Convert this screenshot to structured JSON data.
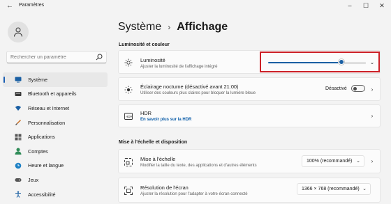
{
  "app": {
    "title": "Paramètres"
  },
  "search": {
    "placeholder": "Rechercher un paramètre"
  },
  "nav": {
    "items": [
      {
        "label": "Système",
        "icon": "monitor-icon",
        "active": true
      },
      {
        "label": "Bluetooth et appareils",
        "icon": "bluetooth-icon"
      },
      {
        "label": "Réseau et Internet",
        "icon": "wifi-icon"
      },
      {
        "label": "Personnalisation",
        "icon": "brush-icon"
      },
      {
        "label": "Applications",
        "icon": "apps-icon"
      },
      {
        "label": "Comptes",
        "icon": "person-icon"
      },
      {
        "label": "Heure et langue",
        "icon": "globe-clock-icon"
      },
      {
        "label": "Jeux",
        "icon": "gamepad-icon"
      },
      {
        "label": "Accessibilité",
        "icon": "accessibility-icon"
      }
    ]
  },
  "breadcrumb": {
    "parent": "Système",
    "separator": "›",
    "current": "Affichage"
  },
  "sections": {
    "brightness": "Luminosité et couleur",
    "scale": "Mise à l'échelle et disposition"
  },
  "cards": {
    "brightness": {
      "title": "Luminosité",
      "subtitle": "Ajuster la luminosité de l'affichage intégré",
      "level": 0.75
    },
    "night": {
      "title": "Éclairage nocturne (désactivé avant 21:00)",
      "subtitle": "Utiliser des couleurs plus claires pour bloquer la lumière bleue",
      "toggle_label": "Désactivé"
    },
    "hdr": {
      "title": "HDR",
      "link": "En savoir plus sur la HDR"
    },
    "scale": {
      "title": "Mise à l'échelle",
      "subtitle": "Modifier la taille du texte, des applications et d'autres éléments",
      "value": "100% (recommandé)"
    },
    "resolution": {
      "title": "Résolution de l'écran",
      "subtitle": "Ajuster la résolution pour l'adapter à  votre  écran connecté",
      "value": "1366 × 768 (recommandé)"
    }
  },
  "colors": {
    "accent": "#1a5fa3",
    "highlight": "#cc2027"
  }
}
